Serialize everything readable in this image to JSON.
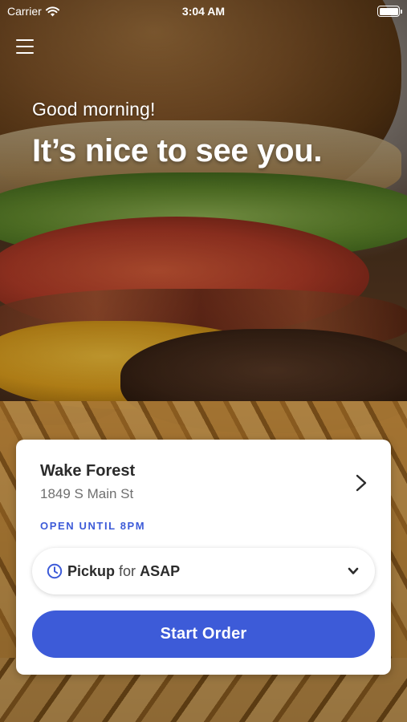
{
  "status_bar": {
    "carrier": "Carrier",
    "time": "3:04 AM",
    "wifi_icon": "wifi-icon",
    "battery_icon": "battery-icon"
  },
  "header": {
    "menu_icon": "hamburger-menu-icon",
    "greeting": "Good morning!",
    "headline": "It’s nice to see you."
  },
  "background": {
    "description_icon": "burger-and-fries-photo"
  },
  "location_card": {
    "store_name": "Wake Forest",
    "address": "1849 S Main St",
    "hours_status": "OPEN UNTIL 8PM",
    "chevron_icon": "chevron-right-icon",
    "order_mode": {
      "icon": "clock-icon",
      "mode_label": "Pickup",
      "connector": "for",
      "time_label": "ASAP",
      "dropdown_icon": "chevron-down-icon"
    },
    "start_order_label": "Start Order"
  },
  "colors": {
    "accent": "#3d5bd8",
    "card_background": "#ffffff",
    "title_text": "#2b2b2b",
    "secondary_text": "#6f6f6f"
  }
}
